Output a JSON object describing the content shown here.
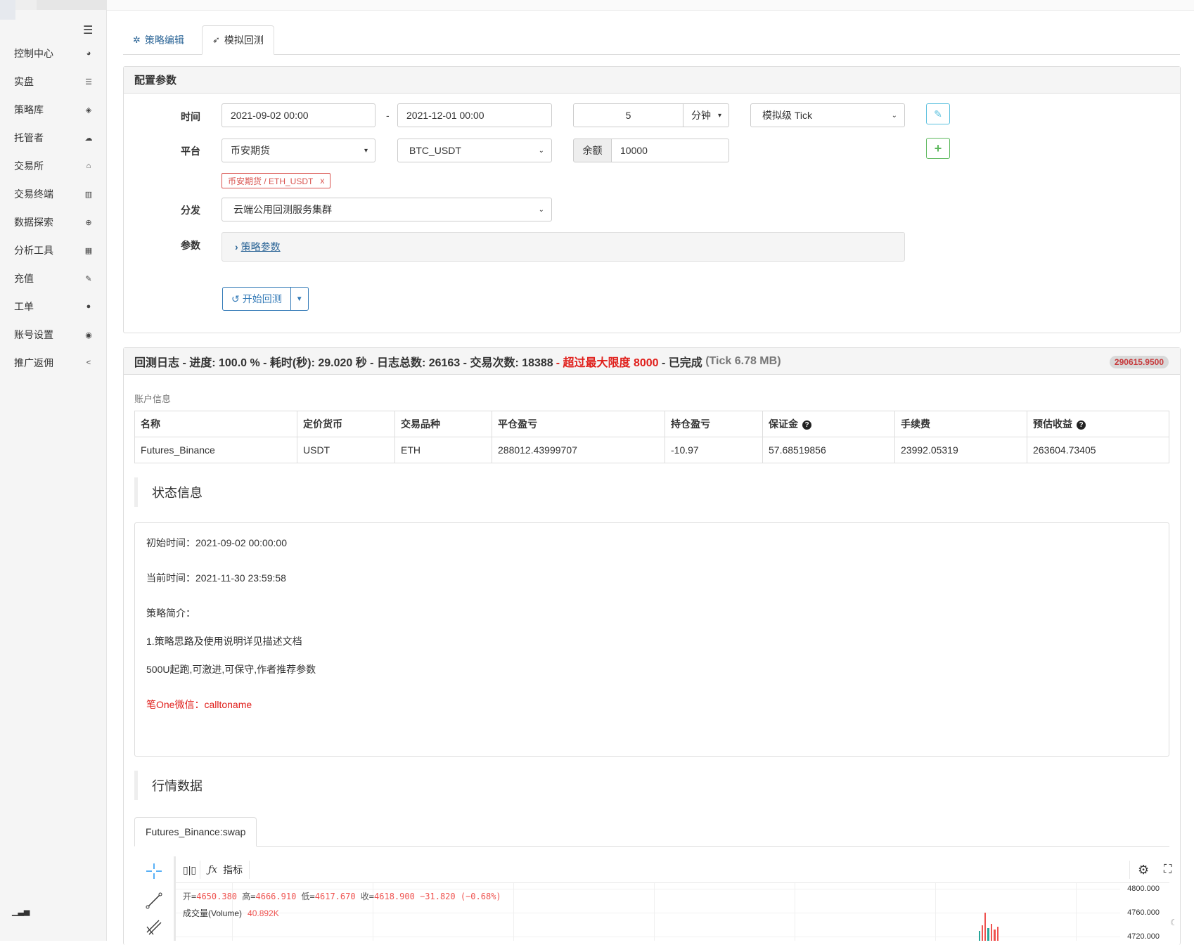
{
  "sidebar": {
    "menu_icon": "hamburger-icon",
    "items": [
      {
        "label": "控制中心",
        "icon": "dashboard-icon",
        "glyph": "◕"
      },
      {
        "label": "实盘",
        "icon": "list-icon",
        "glyph": "☰"
      },
      {
        "label": "策略库",
        "icon": "cube-icon",
        "glyph": "◈"
      },
      {
        "label": "托管者",
        "icon": "cloud-icon",
        "glyph": "☁"
      },
      {
        "label": "交易所",
        "icon": "bank-icon",
        "glyph": "⌂"
      },
      {
        "label": "交易终端",
        "icon": "bar-chart-icon",
        "glyph": "▥"
      },
      {
        "label": "数据探索",
        "icon": "search-plus-icon",
        "glyph": "⊕"
      },
      {
        "label": "分析工具",
        "icon": "calculator-icon",
        "glyph": "▦"
      },
      {
        "label": "充值",
        "icon": "plug-icon",
        "glyph": "✎"
      },
      {
        "label": "工单",
        "icon": "comment-icon",
        "glyph": "●"
      },
      {
        "label": "账号设置",
        "icon": "user-circle-icon",
        "glyph": "◉"
      },
      {
        "label": "推广返佣",
        "icon": "share-icon",
        "glyph": "<"
      }
    ]
  },
  "tabs": [
    {
      "label": "策略编辑",
      "icon": "cubes-icon"
    },
    {
      "label": "模拟回测",
      "icon": "rocket-icon"
    }
  ],
  "config": {
    "title": "配置参数",
    "time_label": "时间",
    "start_time": "2021-09-02 00:00",
    "range_sep": "-",
    "end_time": "2021-12-01 00:00",
    "period_value": "5",
    "period_unit": "分钟",
    "tick_mode": "模拟级 Tick",
    "platform_label": "平台",
    "exchange": "币安期货",
    "symbol": "BTC_USDT",
    "balance_label": "余额",
    "balance": "10000",
    "added_pair": "币安期货 / ETH_USDT",
    "remove_glyph": "x",
    "dispatch_label": "分发",
    "dispatch": "云端公用回测服务集群",
    "params_label": "参数",
    "strategy_params_link": "策略参数",
    "start_button": "开始回测"
  },
  "log": {
    "title_prefix": "回测日志 - 进度: 100.0 % - 耗时(秒): 29.020 秒 - 日志总数: 26163 - 交易次数: 18388 ",
    "title_warn": "- 超过最大限度 8000",
    "title_done": " - 已完成 ",
    "title_size": "(Tick 6.78 MB)",
    "badge": "290615.9500"
  },
  "account": {
    "label": "账户信息",
    "headers": [
      "名称",
      "定价货币",
      "交易品种",
      "平仓盈亏",
      "持仓盈亏",
      "保证金",
      "手续费",
      "预估收益"
    ],
    "row": [
      "Futures_Binance",
      "USDT",
      "ETH",
      "288012.43999707",
      "-10.97",
      "57.68519856",
      "23992.05319",
      "263604.73405"
    ]
  },
  "status": {
    "title": "状态信息",
    "lines": [
      "初始时间：2021-09-02 00:00:00",
      "当前时间：2021-11-30 23:59:58",
      "策略简介：",
      "1.策略思路及使用说明详见描述文档",
      "500U起跑,可激进,可保守,作者推荐参数",
      "笔One微信：calltoname"
    ]
  },
  "market": {
    "title": "行情数据",
    "tab": "Futures_Binance:swap",
    "indicator_label": "指标",
    "ohlc": {
      "open_label": "开=",
      "open": "4650.380",
      "high_label": "高=",
      "high": "4666.910",
      "low_label": "低=",
      "low": "4617.670",
      "close_label": "收=",
      "close": "4618.900",
      "change": "−31.820 (−0.68%)"
    },
    "volume_label": "成交量(Volume)",
    "volume": "40.892K",
    "y_ticks": [
      "4800.000",
      "4760.000",
      "4720.000"
    ]
  },
  "colors": {
    "link": "#2a6496",
    "warn": "#e0201c",
    "up": "#26a69a",
    "down": "#ef5350"
  }
}
